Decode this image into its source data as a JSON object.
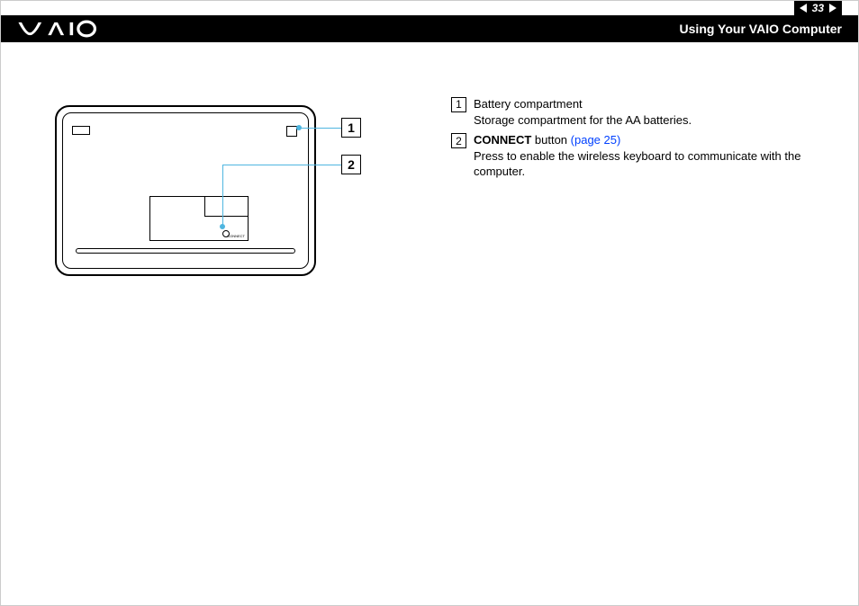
{
  "header": {
    "page_number": "33",
    "section_title": "Using Your VAIO Computer"
  },
  "diagram": {
    "callouts": {
      "c1": "1",
      "c2": "2"
    },
    "labels": {
      "connect": "CONNECT"
    }
  },
  "descriptions": [
    {
      "num": "1",
      "title": "Battery compartment",
      "title_bold": false,
      "link": "",
      "body": "Storage compartment for the AA batteries."
    },
    {
      "num": "2",
      "title_bold_part": "CONNECT",
      "title_rest": " button ",
      "link": "(page 25)",
      "body": "Press to enable the wireless keyboard to communicate with the computer."
    }
  ]
}
